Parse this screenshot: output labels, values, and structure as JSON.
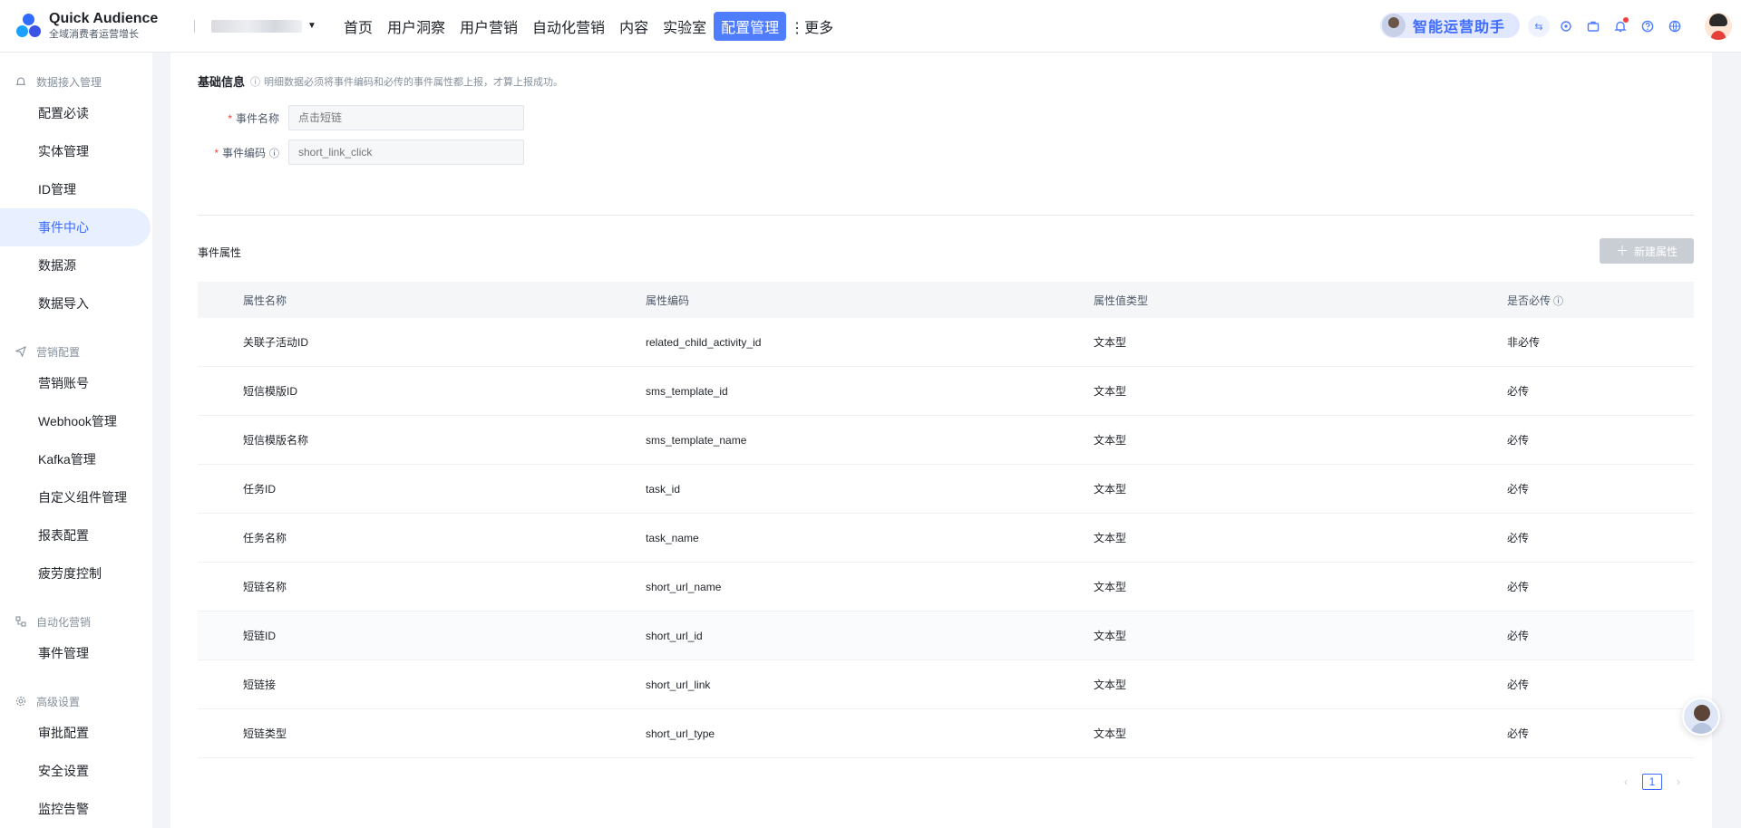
{
  "app": {
    "title": "Quick Audience",
    "subtitle": "全域消费者运营增长"
  },
  "header": {
    "nav": [
      "首页",
      "用户洞察",
      "用户营销",
      "自动化营销",
      "内容",
      "实验室",
      "配置管理"
    ],
    "more": "更多",
    "assistant": "智能运营助手",
    "icons": [
      "swap-icon",
      "connector-icon",
      "briefcase-icon",
      "bell-icon",
      "help-icon",
      "globe-icon"
    ]
  },
  "sidebar": {
    "groups": [
      {
        "label": "数据接入管理",
        "icon": "bell-outline-icon",
        "items": [
          "配置必读",
          "实体管理",
          "ID管理",
          "事件中心",
          "数据源",
          "数据导入"
        ]
      },
      {
        "label": "营销配置",
        "icon": "send-icon",
        "items": [
          "营销账号",
          "Webhook管理",
          "Kafka管理",
          "自定义组件管理",
          "报表配置",
          "疲劳度控制"
        ]
      },
      {
        "label": "自动化营销",
        "icon": "flow-icon",
        "items": [
          "事件管理"
        ]
      },
      {
        "label": "高级设置",
        "icon": "settings-icon",
        "items": [
          "审批配置",
          "安全设置",
          "监控告警"
        ]
      }
    ],
    "active": "事件中心"
  },
  "basic_info": {
    "title": "基础信息",
    "hint": "明细数据必须将事件编码和必传的事件属性都上报，才算上报成功。",
    "event_name_label": "事件名称",
    "event_name_placeholder": "点击短链",
    "event_code_label": "事件编码",
    "event_code_placeholder": "short_link_click"
  },
  "attributes": {
    "title": "事件属性",
    "new_button": "新建属性",
    "columns": [
      "属性名称",
      "属性编码",
      "属性值类型",
      "是否必传"
    ],
    "rows": [
      [
        "关联子活动ID",
        "related_child_activity_id",
        "文本型",
        "非必传"
      ],
      [
        "短信模版ID",
        "sms_template_id",
        "文本型",
        "必传"
      ],
      [
        "短信模版名称",
        "sms_template_name",
        "文本型",
        "必传"
      ],
      [
        "任务ID",
        "task_id",
        "文本型",
        "必传"
      ],
      [
        "任务名称",
        "task_name",
        "文本型",
        "必传"
      ],
      [
        "短链名称",
        "short_url_name",
        "文本型",
        "必传"
      ],
      [
        "短链ID",
        "short_url_id",
        "文本型",
        "必传"
      ],
      [
        "短链接",
        "short_url_link",
        "文本型",
        "必传"
      ],
      [
        "短链类型",
        "short_url_type",
        "文本型",
        "必传"
      ]
    ]
  },
  "pagination": {
    "current": "1"
  },
  "colors": {
    "accent": "#4e7dff",
    "active_bg": "#e8efff",
    "required": "#f53f3f"
  }
}
